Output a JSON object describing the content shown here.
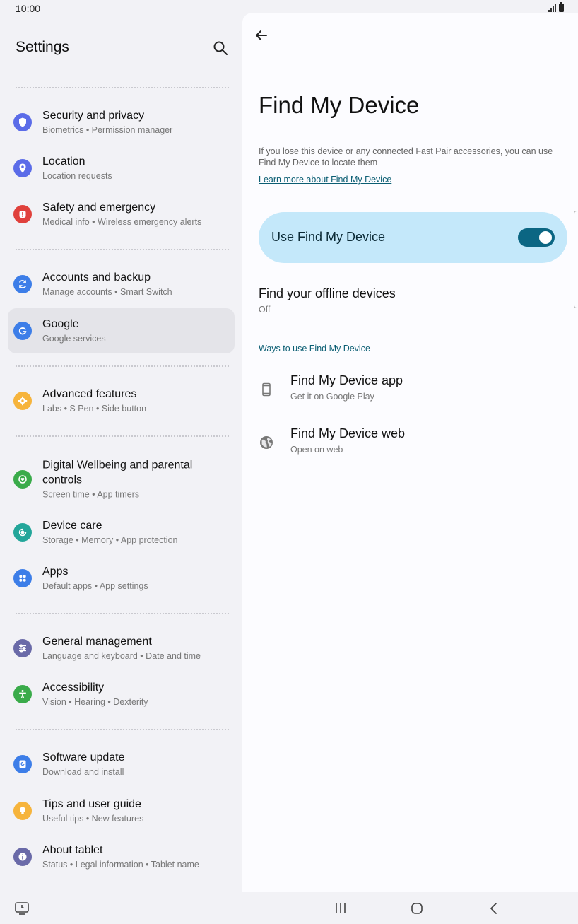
{
  "status_bar": {
    "time": "10:00"
  },
  "sidebar": {
    "title": "Settings",
    "items": [
      {
        "title": "Security and privacy",
        "subtitle": "Biometrics  •  Permission manager",
        "icon": "shield-icon",
        "color": "#5b6ce8"
      },
      {
        "title": "Location",
        "subtitle": "Location requests",
        "icon": "location-pin-icon",
        "color": "#5b6ce8"
      },
      {
        "title": "Safety and emergency",
        "subtitle": "Medical info  •  Wireless emergency alerts",
        "icon": "alert-icon",
        "color": "#e0413c"
      },
      {
        "title": "Accounts and backup",
        "subtitle": "Manage accounts  •  Smart Switch",
        "icon": "sync-icon",
        "color": "#3d7ee8"
      },
      {
        "title": "Google",
        "subtitle": "Google services",
        "icon": "google-icon",
        "color": "#3d7ee8"
      },
      {
        "title": "Advanced features",
        "subtitle": "Labs  •  S Pen  •  Side button",
        "icon": "gear-icon",
        "color": "#f6b43c"
      },
      {
        "title": "Digital Wellbeing and parental controls",
        "subtitle": "Screen time  •  App timers",
        "icon": "wellbeing-icon",
        "color": "#3aab4a"
      },
      {
        "title": "Device care",
        "subtitle": "Storage  •  Memory  •  App protection",
        "icon": "device-care-icon",
        "color": "#23a69a"
      },
      {
        "title": "Apps",
        "subtitle": "Default apps  •  App settings",
        "icon": "apps-grid-icon",
        "color": "#3d7ee8"
      },
      {
        "title": "General management",
        "subtitle": "Language and keyboard  •  Date and time",
        "icon": "sliders-icon",
        "color": "#6a6aa8"
      },
      {
        "title": "Accessibility",
        "subtitle": "Vision  •  Hearing  •  Dexterity",
        "icon": "accessibility-icon",
        "color": "#3aab4a"
      },
      {
        "title": "Software update",
        "subtitle": "Download and install",
        "icon": "software-update-icon",
        "color": "#3d7ee8"
      },
      {
        "title": "Tips and user guide",
        "subtitle": "Useful tips  •  New features",
        "icon": "lightbulb-icon",
        "color": "#f6b43c"
      },
      {
        "title": "About tablet",
        "subtitle": "Status  •  Legal information  •  Tablet name",
        "icon": "info-icon",
        "color": "#6a6aa8"
      }
    ]
  },
  "detail": {
    "title": "Find My Device",
    "description": "If you lose this device or any connected Fast Pair accessories, you can use Find My Device to locate them",
    "learn_more": "Learn more about Find My Device",
    "toggle": {
      "label": "Use Find My Device",
      "enabled": true
    },
    "offline": {
      "title": "Find your offline devices",
      "status": "Off"
    },
    "section_header": "Ways to use Find My Device",
    "ways": [
      {
        "title": "Find My Device app",
        "subtitle": "Get it on Google Play",
        "icon": "phone-icon"
      },
      {
        "title": "Find My Device web",
        "subtitle": "Open on web",
        "icon": "globe-icon"
      }
    ]
  },
  "colors": {
    "accent": "#0b6683",
    "toggle_card": "#c4e8fa",
    "link": "#0b5e73"
  }
}
